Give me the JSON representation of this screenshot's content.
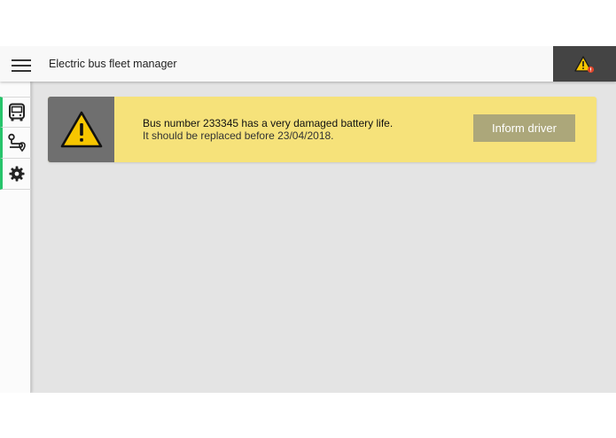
{
  "header": {
    "menu_icon": "hamburger-menu-icon",
    "title": "Electric bus fleet manager",
    "alert_icon": "warning-notification-icon"
  },
  "sidebar": {
    "items": [
      {
        "icon": "bus-icon"
      },
      {
        "icon": "route-icon"
      },
      {
        "icon": "gear-icon"
      }
    ]
  },
  "alert": {
    "icon": "warning-icon",
    "line1": "Bus number 233345 has a very damaged battery life.",
    "line2": "It should be replaced before 23/04/2018.",
    "action_label": "Inform driver"
  },
  "colors": {
    "accent_green": "#27c46b",
    "alert_bg": "#f6e27a",
    "warning_yellow": "#f7c600",
    "button_bg": "#aca77a",
    "header_alert_bg": "#444444"
  }
}
